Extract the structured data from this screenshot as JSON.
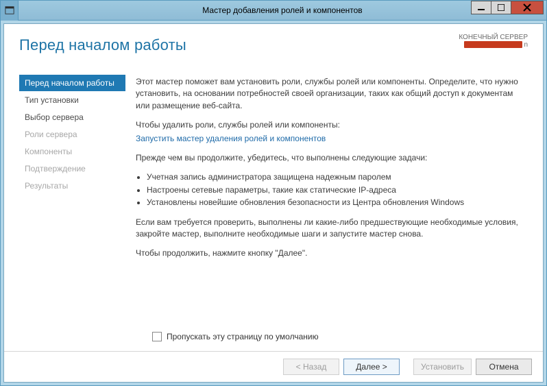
{
  "window": {
    "title": "Мастер добавления ролей и компонентов"
  },
  "header": {
    "page_title": "Перед началом работы",
    "dest_label": "КОНЕЧНЫЙ СЕРВЕР",
    "dest_suffix": "n"
  },
  "nav": {
    "steps": [
      {
        "label": "Перед началом работы",
        "state": "active"
      },
      {
        "label": "Тип установки",
        "state": "enabled"
      },
      {
        "label": "Выбор сервера",
        "state": "enabled"
      },
      {
        "label": "Роли сервера",
        "state": "disabled"
      },
      {
        "label": "Компоненты",
        "state": "disabled"
      },
      {
        "label": "Подтверждение",
        "state": "disabled"
      },
      {
        "label": "Результаты",
        "state": "disabled"
      }
    ]
  },
  "content": {
    "intro": "Этот мастер поможет вам установить роли, службы ролей или компоненты. Определите, что нужно установить, на основании потребностей своей организации, таких как общий доступ к документам или размещение веб-сайта.",
    "remove_intro": "Чтобы удалить роли, службы ролей или компоненты:",
    "remove_link": "Запустить мастер удаления ролей и компонентов",
    "tasks_intro": "Прежде чем вы продолжите, убедитесь, что выполнены следующие задачи:",
    "tasks": [
      "Учетная запись администратора защищена надежным паролем",
      "Настроены сетевые параметры, такие как статические IP-адреса",
      "Установлены новейшие обновления безопасности из Центра обновления Windows"
    ],
    "advice": "Если вам требуется проверить, выполнены ли какие-либо предшествующие необходимые условия, закройте мастер, выполните необходимые шаги и запустите мастер снова.",
    "continue": "Чтобы продолжить, нажмите кнопку \"Далее\"."
  },
  "skip": {
    "label": "Пропускать эту страницу по умолчанию"
  },
  "footer": {
    "back": "< Назад",
    "next": "Далее >",
    "install": "Установить",
    "cancel": "Отмена"
  }
}
